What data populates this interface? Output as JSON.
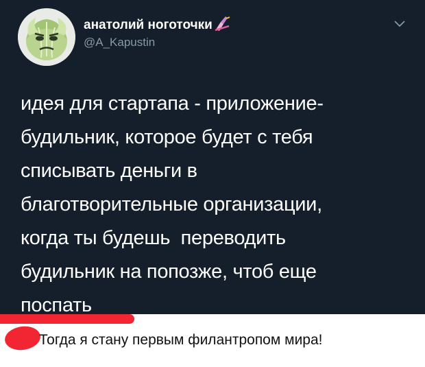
{
  "tweet": {
    "display_name": "анатолий ноготочки",
    "name_emoji_icon": "nail-polish-emoji-icon",
    "handle": "@A_Kapustin",
    "menu_icon": "chevron-down-icon",
    "text_lines": [
      "идея для стартапа - приложение-",
      "будильник, которое будет с тебя",
      "списывать деньги в",
      "благотворительные организации,",
      "когда ты будешь  переводить",
      "будильник на попозже, чтоб еще",
      "поспать"
    ]
  },
  "comment": {
    "text": "Тогда я стану первым филантропом мира!"
  },
  "colors": {
    "tweet_bg": "#151f2b",
    "handle": "#8899a6",
    "marker_red": "#f22633"
  }
}
